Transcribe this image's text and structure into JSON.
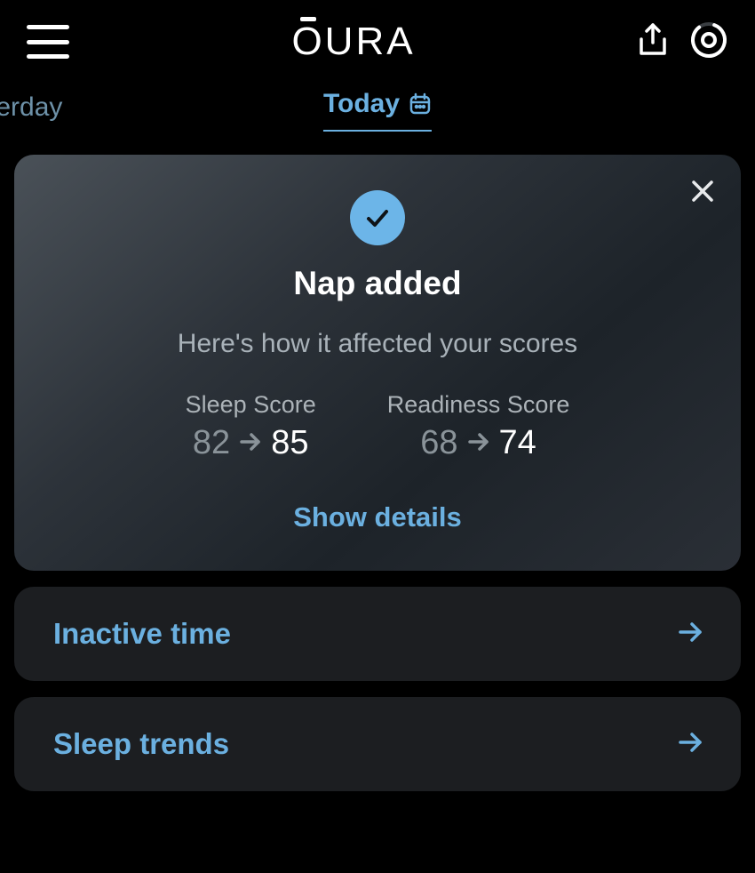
{
  "header": {
    "brand": "OURA"
  },
  "tabs": {
    "yesterday": "sterday",
    "today": "Today"
  },
  "nap_card": {
    "title": "Nap added",
    "subtitle": "Here's how it affected your scores",
    "sleep": {
      "label": "Sleep Score",
      "before": "82",
      "after": "85"
    },
    "readiness": {
      "label": "Readiness Score",
      "before": "68",
      "after": "74"
    },
    "details_label": "Show details"
  },
  "list": {
    "inactive": "Inactive time",
    "sleep_trends": "Sleep trends"
  }
}
